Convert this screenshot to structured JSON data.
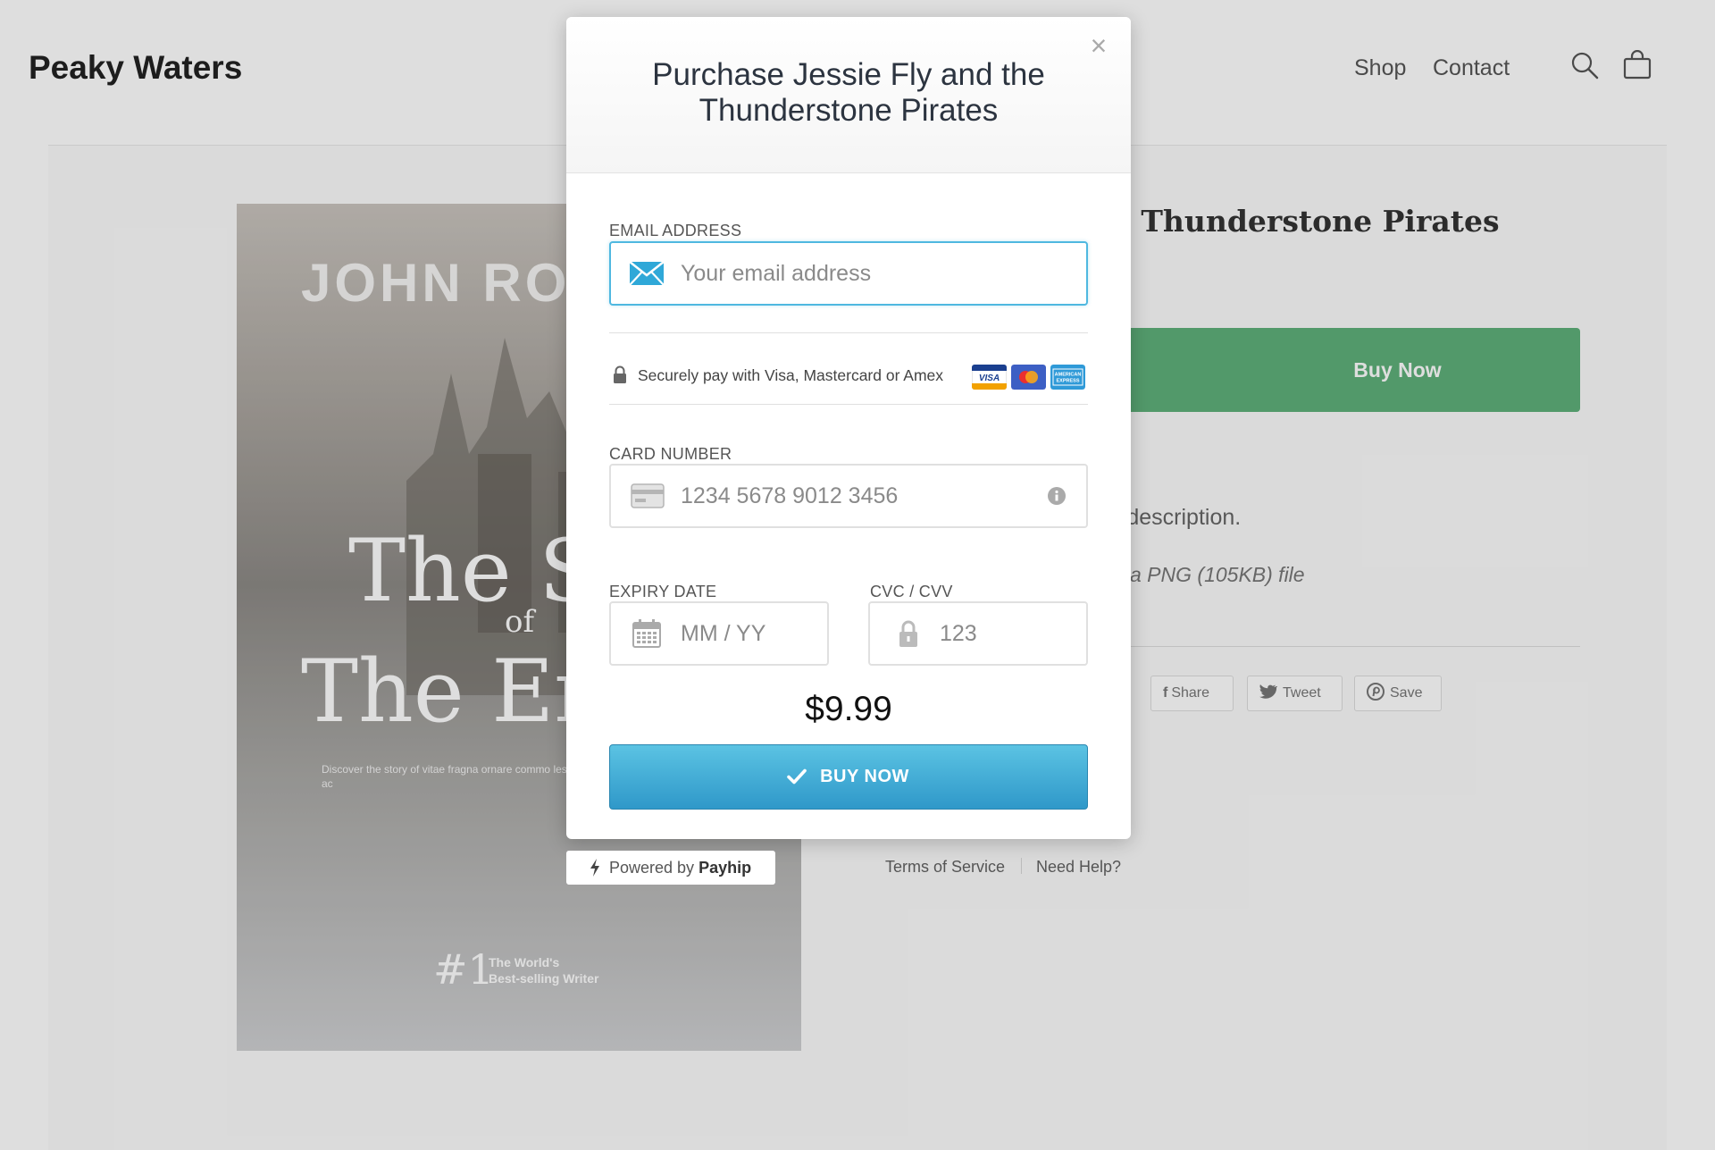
{
  "store": {
    "brand": "Peaky Waters",
    "nav": [
      "Shop",
      "Contact"
    ],
    "product_title": "Jessie Fly and the Thunderstone Pirates",
    "product_title_partial": "y and the Thunderstone Pirates",
    "buy_now_label": "Buy Now",
    "description_partial": "ok description.",
    "file_info_partial": "a PNG (105KB) file",
    "share": {
      "facebook": "Share",
      "twitter": "Tweet",
      "pinterest": "Save"
    }
  },
  "cover": {
    "author": "JOHN RO",
    "title_line1": "The S",
    "title_of": "of",
    "title_line2": "The Em",
    "blurb": "Discover the story of vitae fragna ornare commo les platea commodo diam in ac",
    "rank": "#1",
    "rank_sub_1": "The World's",
    "rank_sub_2": "Best-selling Writer"
  },
  "modal": {
    "title": "Purchase Jessie Fly and the Thunderstone Pirates",
    "close_glyph": "×",
    "email_label": "EMAIL ADDRESS",
    "email_placeholder": "Your email address",
    "secure_text": "Securely pay with Visa, Mastercard or Amex",
    "card_logos": [
      "visa",
      "mastercard",
      "amex"
    ],
    "card_number_label": "CARD NUMBER",
    "card_number_placeholder": "1234 5678 9012 3456",
    "expiry_label": "EXPIRY DATE",
    "expiry_placeholder": "MM / YY",
    "cvc_label": "CVC / CVV",
    "cvc_placeholder": "123",
    "price": "$9.99",
    "buy_button": "BUY NOW"
  },
  "footer": {
    "powered_prefix": "Powered by",
    "powered_brand": "Payhip",
    "terms": "Terms of Service",
    "help": "Need Help?"
  },
  "colors": {
    "accent": "#4fb8e0",
    "buy_button": "#2f98c9",
    "bg_buy_button": "#5fb07a"
  }
}
